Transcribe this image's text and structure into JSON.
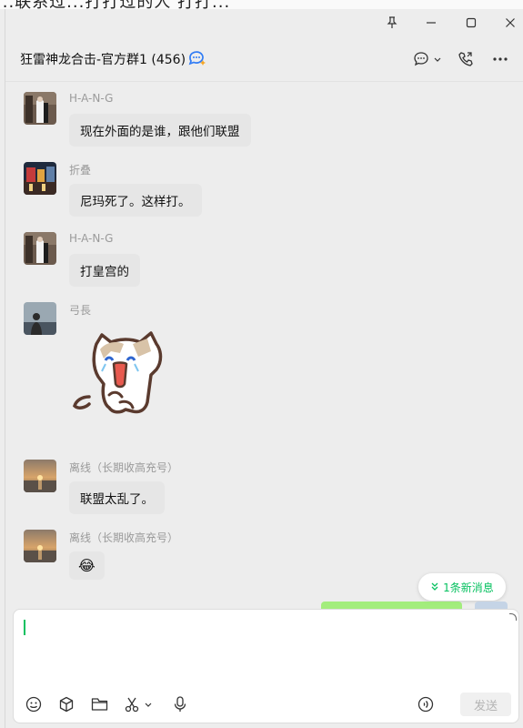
{
  "behind_window": {
    "partial_text": "...联系过...打打过的人 打打..."
  },
  "chat": {
    "title": "狂雷神龙合击-官方群1 (456)"
  },
  "messages": [
    {
      "sender": "H-A-N-G",
      "text": "现在外面的是谁，跟他们联盟"
    },
    {
      "sender": "折叠",
      "text": "尼玛死了。这样打。"
    },
    {
      "sender": "H-A-N-G",
      "text": "打皇宫的"
    },
    {
      "sender": "弓長",
      "type": "sticker",
      "sticker": "laughing-cat-sticker"
    },
    {
      "sender": "离线（长期收高充号）",
      "text": "联盟太乱了。"
    },
    {
      "sender": "离线（长期收高充号）",
      "text": "😂"
    }
  ],
  "new_messages": {
    "label": "1条新消息"
  },
  "composer": {
    "send_label": "发送"
  },
  "colors": {
    "accent": "#07c160",
    "bubble": "#e6e6e6"
  }
}
